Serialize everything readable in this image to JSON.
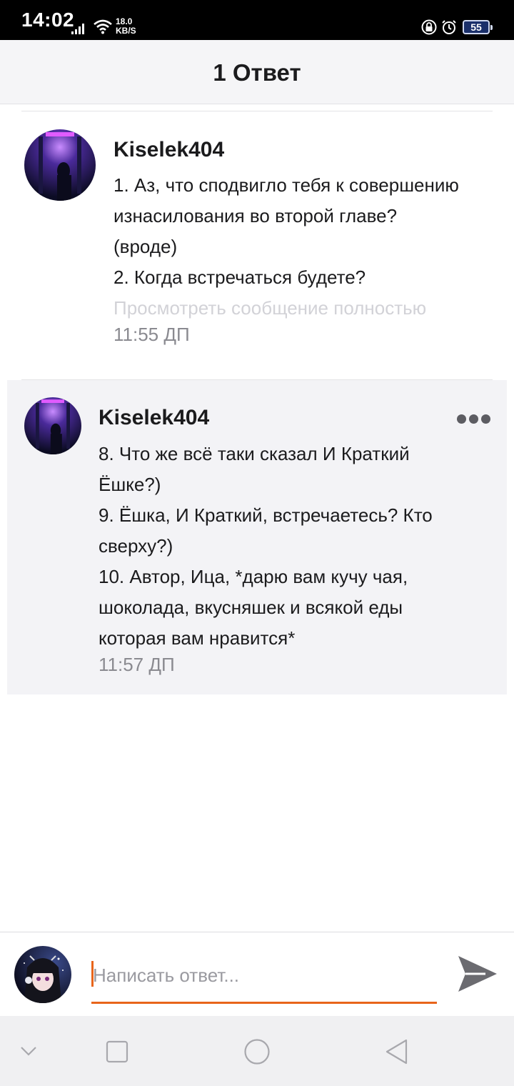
{
  "status_bar": {
    "time": "14:02",
    "net_speed_value": "18.0",
    "net_speed_unit": "KB/S",
    "battery": "55"
  },
  "header": {
    "title": "1 Ответ"
  },
  "parent_comment": {
    "username": "Kiselek404",
    "lines": [
      "1. Аз, что сподвигло тебя к совершению",
      "изнасилования во второй главе?",
      "(вроде)",
      "2. Когда встречаться будете?"
    ],
    "view_full_label": "Просмотреть сообщение полностью",
    "time": "11:55 ДП"
  },
  "reply": {
    "username": "Kiselek404",
    "lines": [
      "8. Что же всё таки сказал И Краткий",
      "Ёшке?)",
      "9. Ёшка, И Краткий, встречаетесь? Кто",
      "сверху?)",
      "10. Автор, Ица, *дарю вам кучу чая,",
      "шоколада, вкусняшек и всякой еды",
      "которая вам нравится*"
    ],
    "time": "11:57 ДП"
  },
  "composer": {
    "placeholder": "Написать ответ...",
    "value": ""
  },
  "colors": {
    "accent": "#e8651b",
    "text": "#1b1b1d",
    "muted": "#8a8a90",
    "reply_background": "#f3f3f6"
  },
  "icons": {
    "more": "more-dots-icon",
    "send": "send-icon",
    "nav_back": "nav-back-icon",
    "nav_home": "nav-home-icon",
    "nav_recents": "nav-recents-icon",
    "nav_collapse": "nav-collapse-icon"
  }
}
